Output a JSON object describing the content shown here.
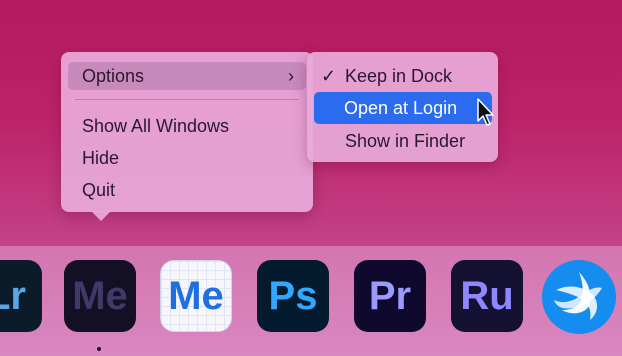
{
  "context_menu": {
    "options_label": "Options",
    "options_chevron": "›",
    "show_all_windows_label": "Show All Windows",
    "hide_label": "Hide",
    "quit_label": "Quit"
  },
  "submenu": {
    "keep_in_dock_label": "Keep in Dock",
    "keep_in_dock_checked": "✓",
    "open_at_login_label": "Open at Login",
    "show_in_finder_label": "Show in Finder",
    "highlight_color": "#2a6bf0"
  },
  "dock": {
    "apps": [
      {
        "label": "Lr",
        "icon": "lightroom-icon"
      },
      {
        "label": "Me",
        "icon": "media-encoder-dark-icon"
      },
      {
        "label": "Me",
        "icon": "media-encoder-light-icon"
      },
      {
        "label": "Ps",
        "icon": "photoshop-icon"
      },
      {
        "label": "Pr",
        "icon": "premiere-icon"
      },
      {
        "label": "Ru",
        "icon": "premiere-rush-icon"
      },
      {
        "label": "",
        "icon": "battle-net-icon"
      }
    ]
  }
}
